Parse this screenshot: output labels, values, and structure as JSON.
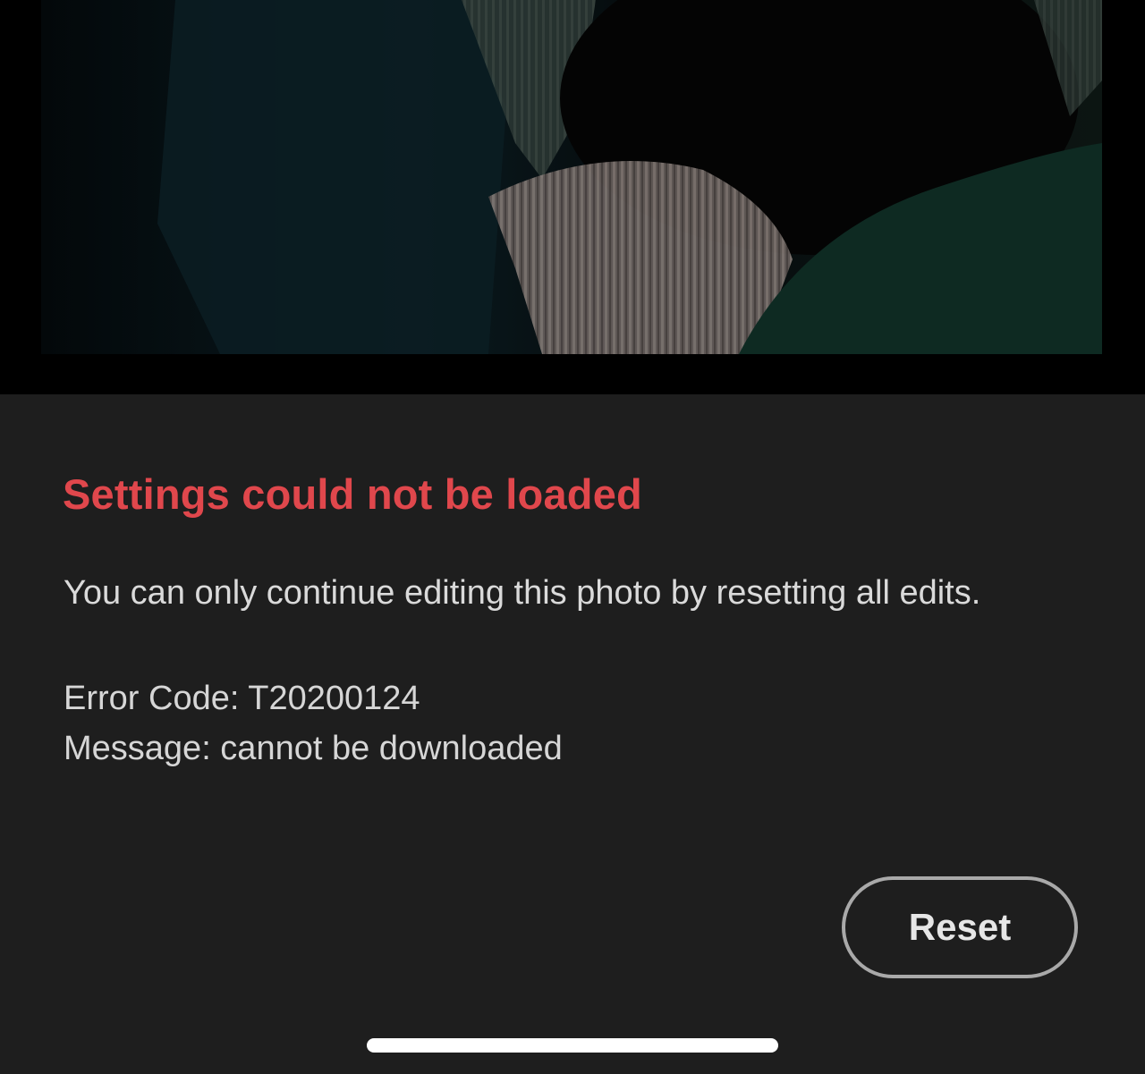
{
  "dialog": {
    "title": "Settings could not be loaded",
    "message": "You can only continue editing this photo by resetting all edits.",
    "error_code_line": "Error Code: T20200124",
    "error_message_line": "Message: cannot be downloaded",
    "reset_label": "Reset"
  },
  "colors": {
    "background": "#1e1e1e",
    "title_red": "#e0474c",
    "text": "#dadada",
    "button_border": "#a9a9a9",
    "home_indicator": "#ffffff"
  }
}
